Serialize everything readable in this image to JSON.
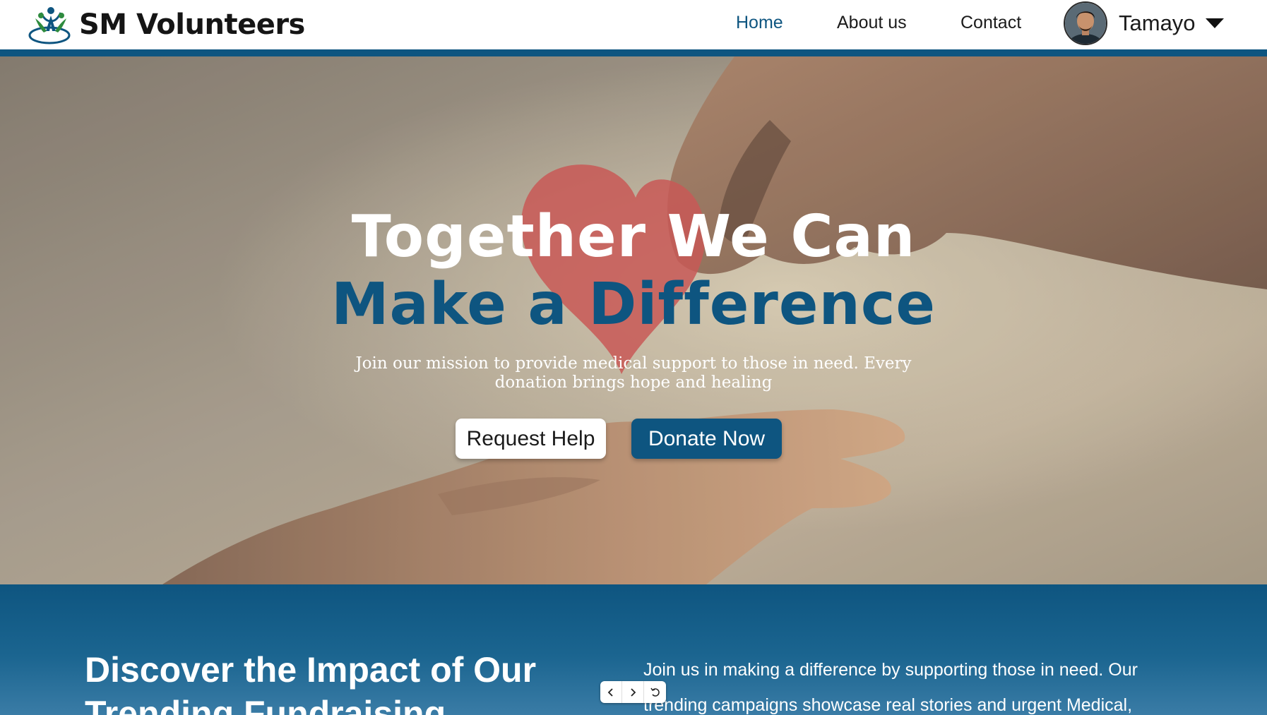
{
  "brand": {
    "name": "SM Volunteers",
    "primary_color": "#0e5580"
  },
  "nav": {
    "links": [
      {
        "label": "Home",
        "active": true
      },
      {
        "label": "About us",
        "active": false
      },
      {
        "label": "Contact",
        "active": false
      }
    ],
    "user": {
      "name": "Tamayo",
      "avatar_icon": "user-avatar",
      "menu_icon": "caret-down-icon"
    }
  },
  "hero": {
    "title_line1": "Together We Can",
    "title_line2": "Make a Difference",
    "subtitle": "Join our mission to provide medical support to those in need. Every donation brings hope and healing",
    "request_label": "Request Help",
    "donate_label": "Donate Now"
  },
  "impact": {
    "title": "Discover the Impact of Our Trending Fundraising",
    "text": "Join us in making a difference by supporting those in need. Our trending campaigns showcase real stories and urgent Medical,"
  },
  "slider_controls": {
    "icons": [
      "chevron-left-icon",
      "chevron-right-icon",
      "reset-icon"
    ]
  }
}
